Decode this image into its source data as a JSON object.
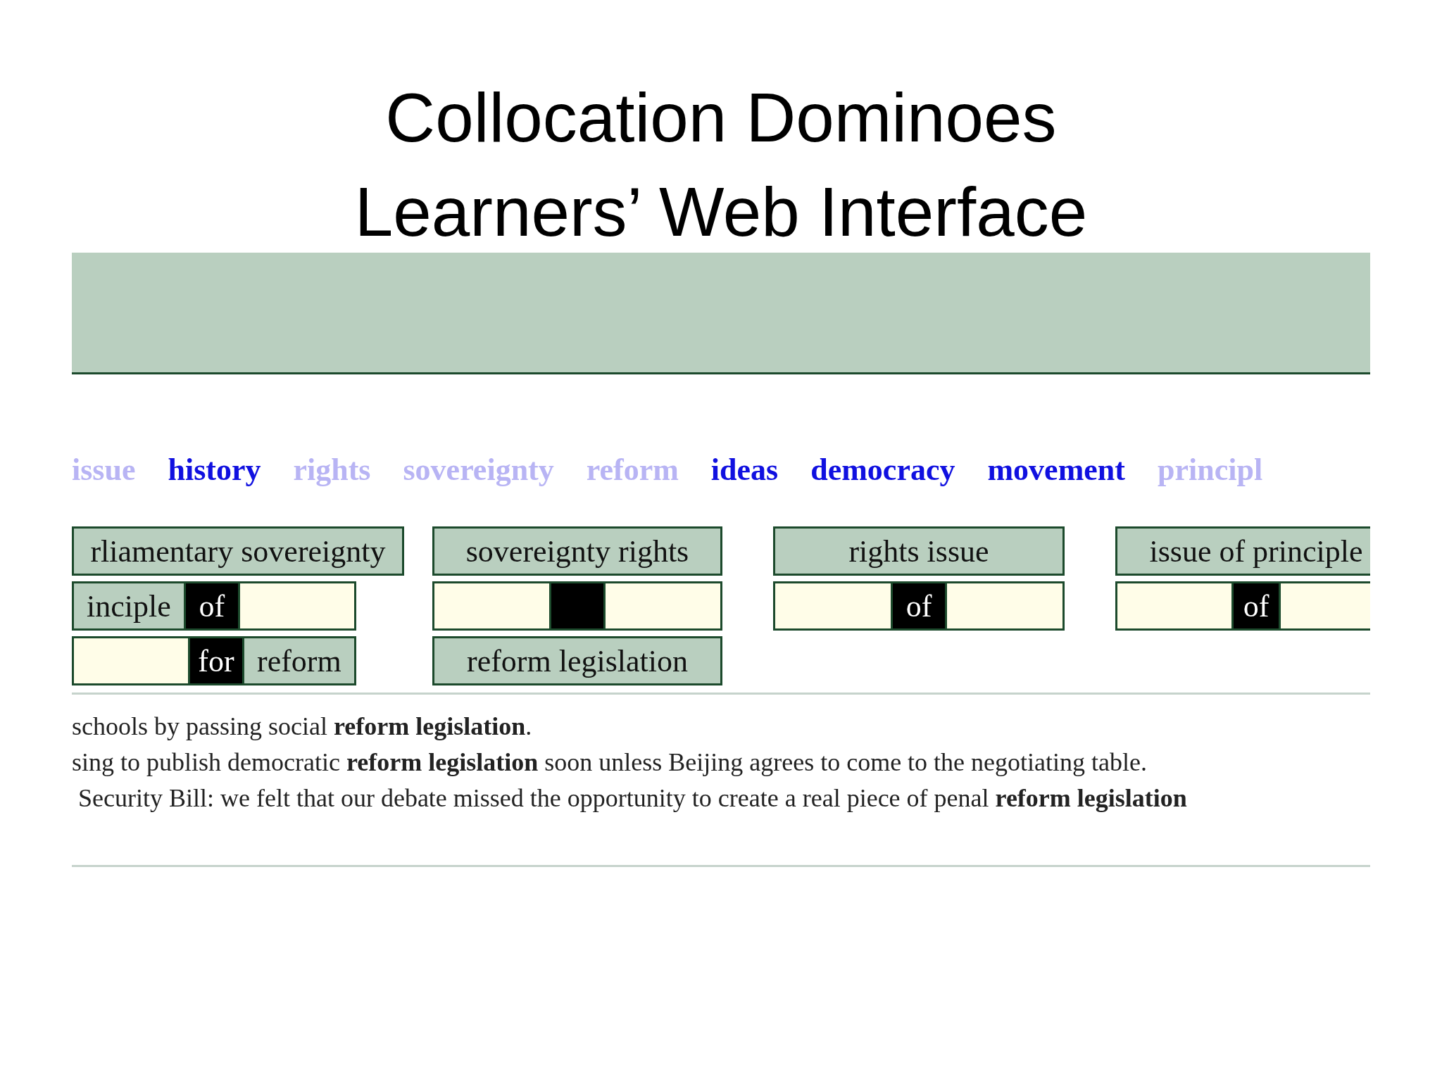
{
  "title": [
    "Collocation Dominoes",
    "Learners’ Web Interface"
  ],
  "words": [
    {
      "text": "issue",
      "active": false
    },
    {
      "text": "history",
      "active": true
    },
    {
      "text": "rights",
      "active": false
    },
    {
      "text": "sovereignty",
      "active": false
    },
    {
      "text": "reform",
      "active": false
    },
    {
      "text": "ideas",
      "active": true
    },
    {
      "text": "democracy",
      "active": true
    },
    {
      "text": "movement",
      "active": true
    },
    {
      "text": "principl",
      "active": false
    }
  ],
  "dominoes": [
    {
      "rows": [
        [
          {
            "kind": "word",
            "text": "rliamentary sovereignty"
          }
        ],
        [
          {
            "kind": "word",
            "text": "inciple"
          },
          {
            "kind": "link",
            "text": "of"
          },
          {
            "kind": "slot"
          }
        ],
        [
          {
            "kind": "slot"
          },
          {
            "kind": "link",
            "text": "for"
          },
          {
            "kind": "word",
            "text": "reform"
          }
        ]
      ]
    },
    {
      "rows": [
        [
          {
            "kind": "word",
            "text": "sovereignty rights"
          }
        ],
        [
          {
            "kind": "slot"
          },
          {
            "kind": "link"
          },
          {
            "kind": "slot"
          }
        ],
        [
          {
            "kind": "word",
            "text": "reform legislation"
          }
        ]
      ]
    },
    {
      "rows": [
        [
          {
            "kind": "word",
            "text": "rights issue"
          }
        ],
        [
          {
            "kind": "slot"
          },
          {
            "kind": "link",
            "text": "of"
          },
          {
            "kind": "slot"
          }
        ]
      ]
    },
    {
      "rows": [
        [
          {
            "kind": "word",
            "text": "issue of principle"
          }
        ],
        [
          {
            "kind": "slot"
          },
          {
            "kind": "link",
            "text": "of"
          },
          {
            "kind": "slot"
          }
        ]
      ]
    }
  ],
  "concordance": [
    "schools by passing social **reform legislation**.",
    "sing to publish democratic **reform legislation** soon unless Beijing agrees to come to the negotiating table.",
    " Security Bill: we felt that our debate missed the opportunity to create a real piece of penal **reform legislation**"
  ]
}
